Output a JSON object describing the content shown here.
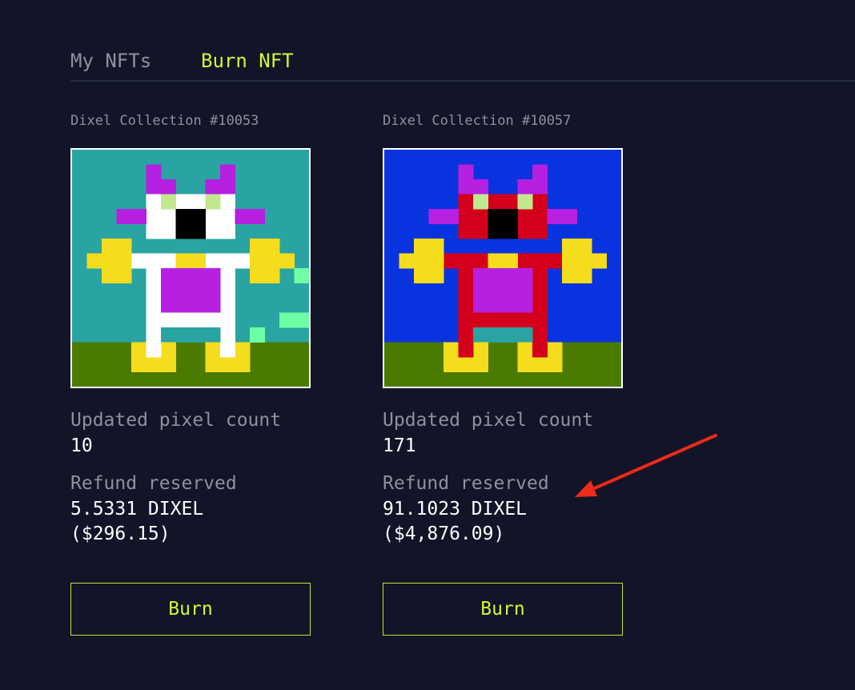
{
  "tabs": [
    {
      "label": "My NFTs",
      "active": false
    },
    {
      "label": "Burn NFT",
      "active": true
    }
  ],
  "cards": [
    {
      "title": "Dixel Collection #10053",
      "pixel_count_label": "Updated pixel count",
      "pixel_count": "10",
      "refund_label": "Refund reserved",
      "refund_amount": "5.5331 DIXEL",
      "refund_usd": "($296.15)",
      "burn_label": "Burn",
      "art": {
        "background": "#29a4a2",
        "body": "#ffffff",
        "ground": "#4a7a00"
      }
    },
    {
      "title": "Dixel Collection #10057",
      "pixel_count_label": "Updated pixel count",
      "pixel_count": "171",
      "refund_label": "Refund reserved",
      "refund_amount": "91.1023 DIXEL",
      "refund_usd": "($4,876.09)",
      "burn_label": "Burn",
      "art": {
        "background": "#0a33e0",
        "body": "#d4001b",
        "ground": "#4a7a00"
      }
    }
  ],
  "colors": {
    "accent": "#d8f438",
    "annotation_arrow": "#ee2a1a"
  }
}
